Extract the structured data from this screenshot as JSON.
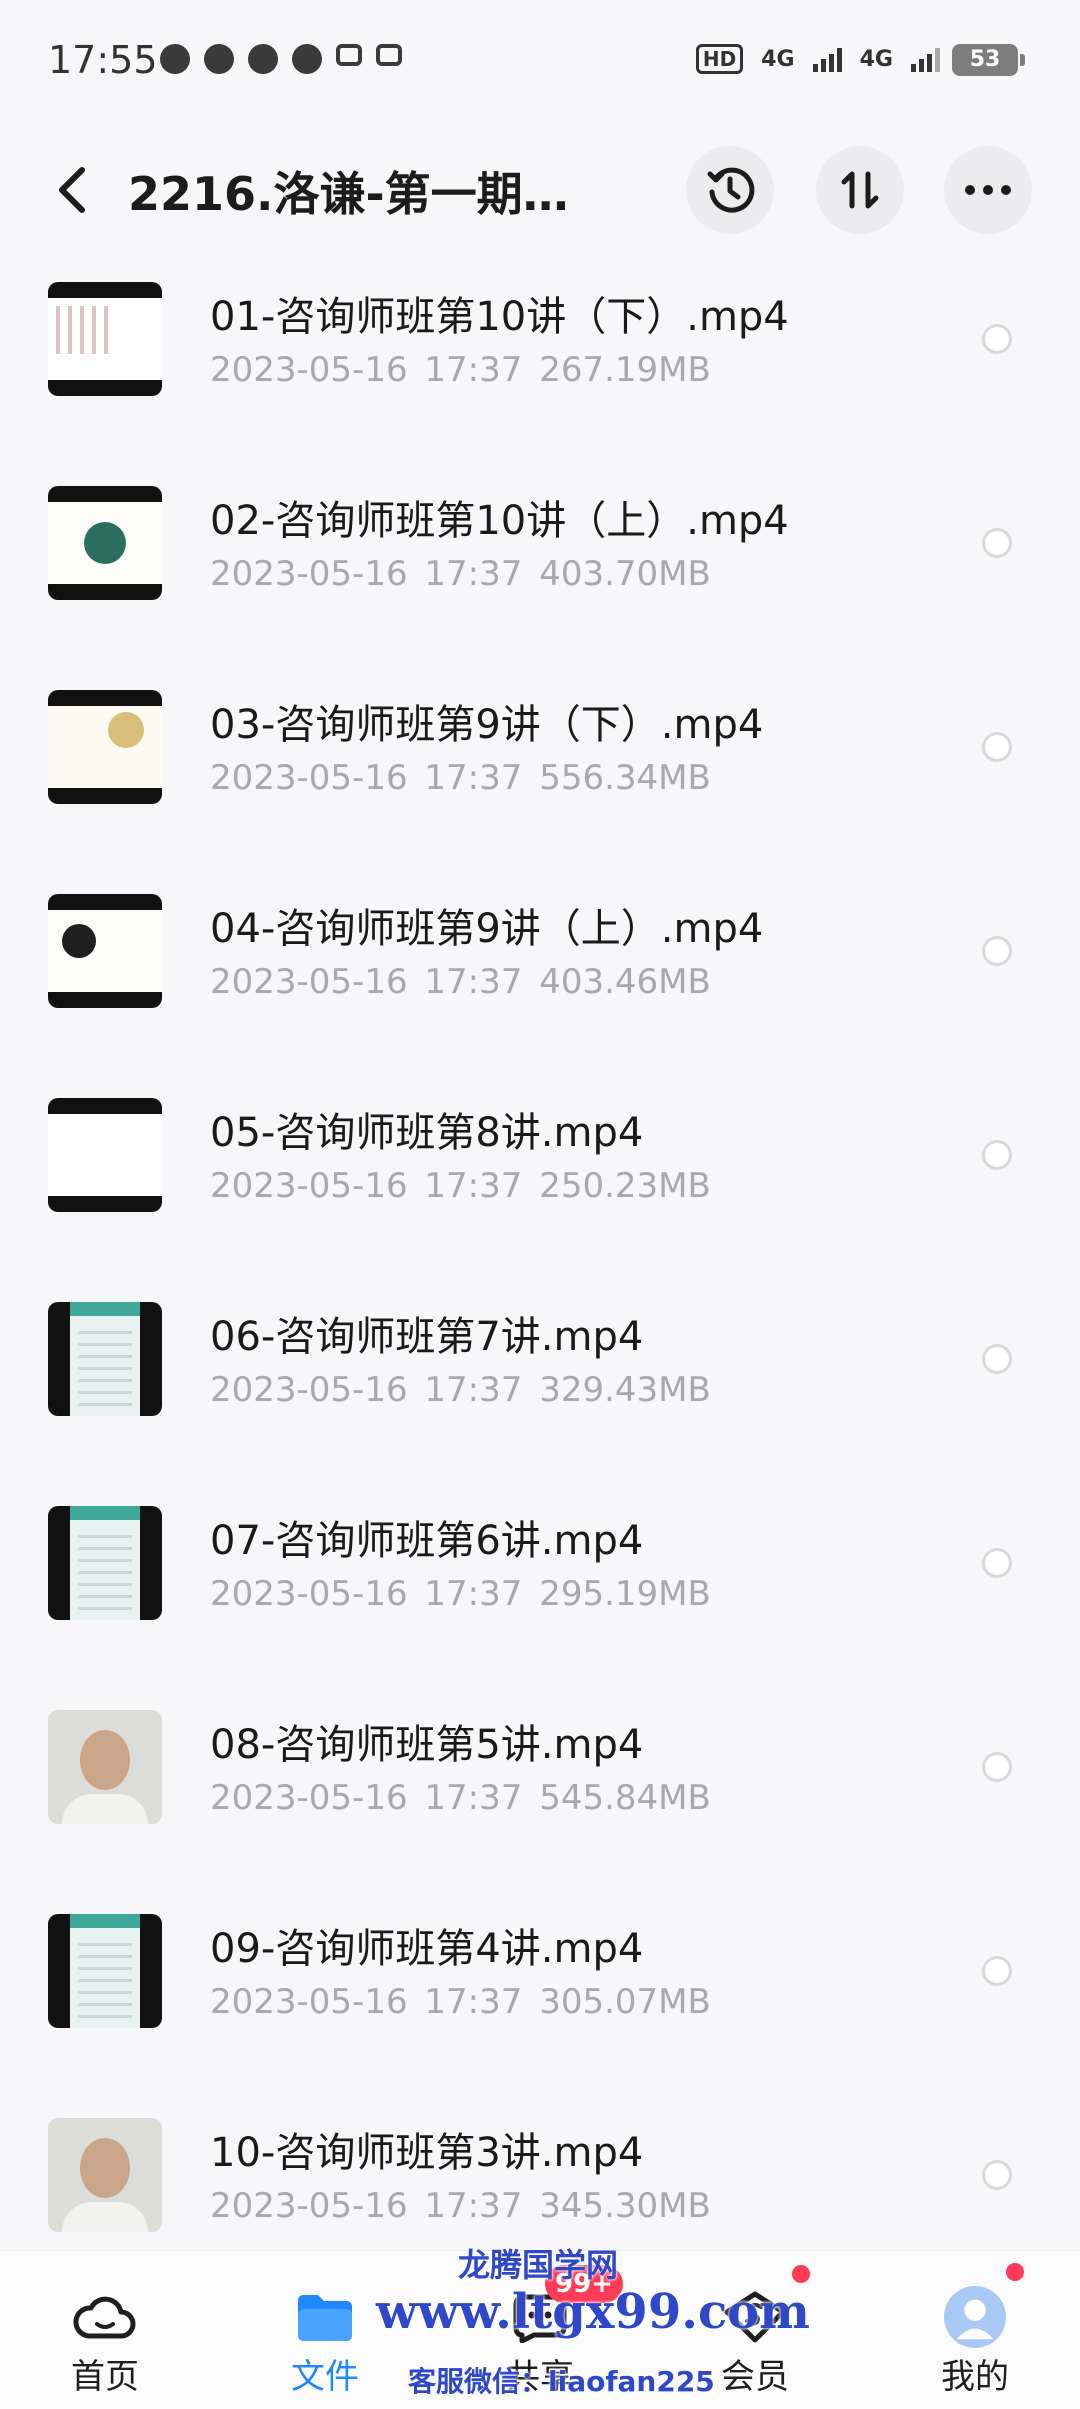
{
  "status_bar": {
    "time": "17:55",
    "hd": "HD",
    "net1": "4G",
    "net2": "4G",
    "battery": "53"
  },
  "header": {
    "title": "2216.洛谦-第一期…",
    "back_icon": "chevron-left-icon",
    "history_icon": "history-icon",
    "sort_icon": "sort-icon",
    "more_icon": "more-icon"
  },
  "files": [
    {
      "name": "01-咨询师班第10讲（下）.mp4",
      "meta": "2023-05-16  17:37  267.19MB"
    },
    {
      "name": "02-咨询师班第10讲（上）.mp4",
      "meta": "2023-05-16  17:37  403.70MB"
    },
    {
      "name": "03-咨询师班第9讲（下）.mp4",
      "meta": "2023-05-16  17:37  556.34MB"
    },
    {
      "name": "04-咨询师班第9讲（上）.mp4",
      "meta": "2023-05-16  17:37  403.46MB"
    },
    {
      "name": "05-咨询师班第8讲.mp4",
      "meta": "2023-05-16  17:37  250.23MB"
    },
    {
      "name": "06-咨询师班第7讲.mp4",
      "meta": "2023-05-16  17:37  329.43MB"
    },
    {
      "name": "07-咨询师班第6讲.mp4",
      "meta": "2023-05-16  17:37  295.19MB"
    },
    {
      "name": "08-咨询师班第5讲.mp4",
      "meta": "2023-05-16  17:37  545.84MB"
    },
    {
      "name": "09-咨询师班第4讲.mp4",
      "meta": "2023-05-16  17:37  305.07MB"
    },
    {
      "name": "10-咨询师班第3讲.mp4",
      "meta": "2023-05-16  17:37  345.30MB"
    }
  ],
  "nav": {
    "home": "首页",
    "files": "文件",
    "share": "共享",
    "vip": "会员",
    "me": "我的",
    "share_badge": "99+"
  },
  "watermark": {
    "title": "龙腾国学网",
    "url": "www.ltgx99.com",
    "contact": "客服微信：liaofan225"
  },
  "colors": {
    "accent": "#1e88ff",
    "badge": "#ff3b57",
    "meta_text": "#a8a8ad",
    "watermark": "#2f47c9"
  }
}
